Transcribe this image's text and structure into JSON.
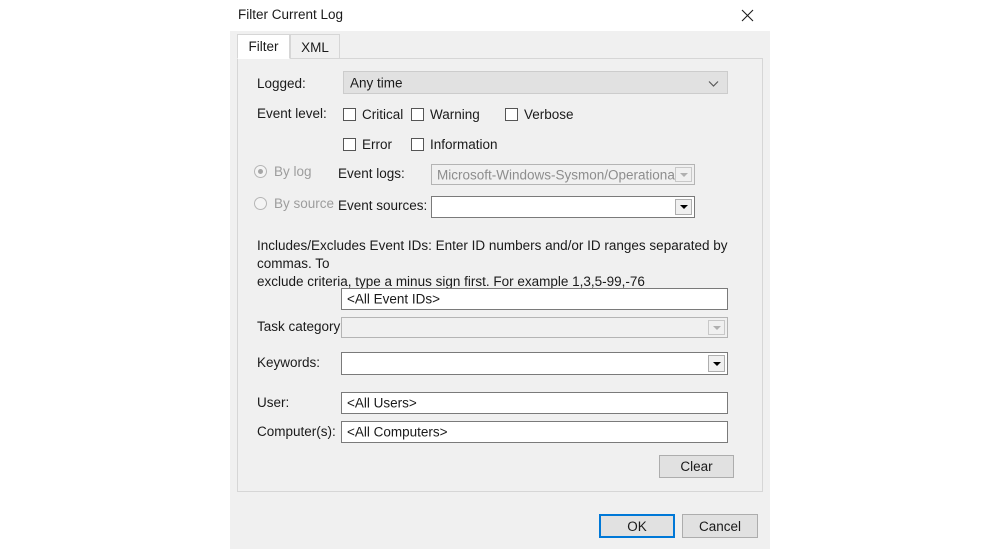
{
  "dialog": {
    "title": "Filter Current Log",
    "close_icon": "close-icon"
  },
  "tabs": [
    {
      "label": "Filter",
      "active": true
    },
    {
      "label": "XML",
      "active": false
    }
  ],
  "form": {
    "logged": {
      "label": "Logged:",
      "value": "Any time",
      "chevron_icon": "chevron-down-icon"
    },
    "event_level": {
      "label": "Event level:",
      "checkboxes": [
        {
          "label": "Critical",
          "checked": false
        },
        {
          "label": "Warning",
          "checked": false
        },
        {
          "label": "Verbose",
          "checked": false
        },
        {
          "label": "Error",
          "checked": false
        },
        {
          "label": "Information",
          "checked": false
        }
      ]
    },
    "source_mode": {
      "by_log": {
        "label": "By log",
        "selected": true,
        "disabled": true
      },
      "by_source": {
        "label": "By source",
        "selected": false,
        "disabled": true
      }
    },
    "event_logs": {
      "label": "Event logs:",
      "value": "Microsoft-Windows-Sysmon/Operational",
      "disabled": true
    },
    "event_sources": {
      "label": "Event sources:",
      "value": "",
      "disabled": false
    },
    "event_ids": {
      "help_line1": "Includes/Excludes Event IDs: Enter ID numbers and/or ID ranges separated by commas. To",
      "help_line2": "exclude criteria, type a minus sign first. For example 1,3,5-99,-76",
      "value": "<All Event IDs>"
    },
    "task_category": {
      "label": "Task category:",
      "value": "",
      "disabled": true
    },
    "keywords": {
      "label": "Keywords:",
      "value": "",
      "disabled": false
    },
    "user": {
      "label": "User:",
      "value": "<All Users>"
    },
    "computers": {
      "label": "Computer(s):",
      "value": "<All Computers>"
    },
    "clear_button": "Clear"
  },
  "footer": {
    "ok": "OK",
    "cancel": "Cancel"
  },
  "colors": {
    "accent": "#0078d7",
    "dialog_bg": "#f0f0f0",
    "titlebar_bg": "#ffffff",
    "text": "#1a1a1a",
    "disabled_text": "#9d9d9d"
  }
}
